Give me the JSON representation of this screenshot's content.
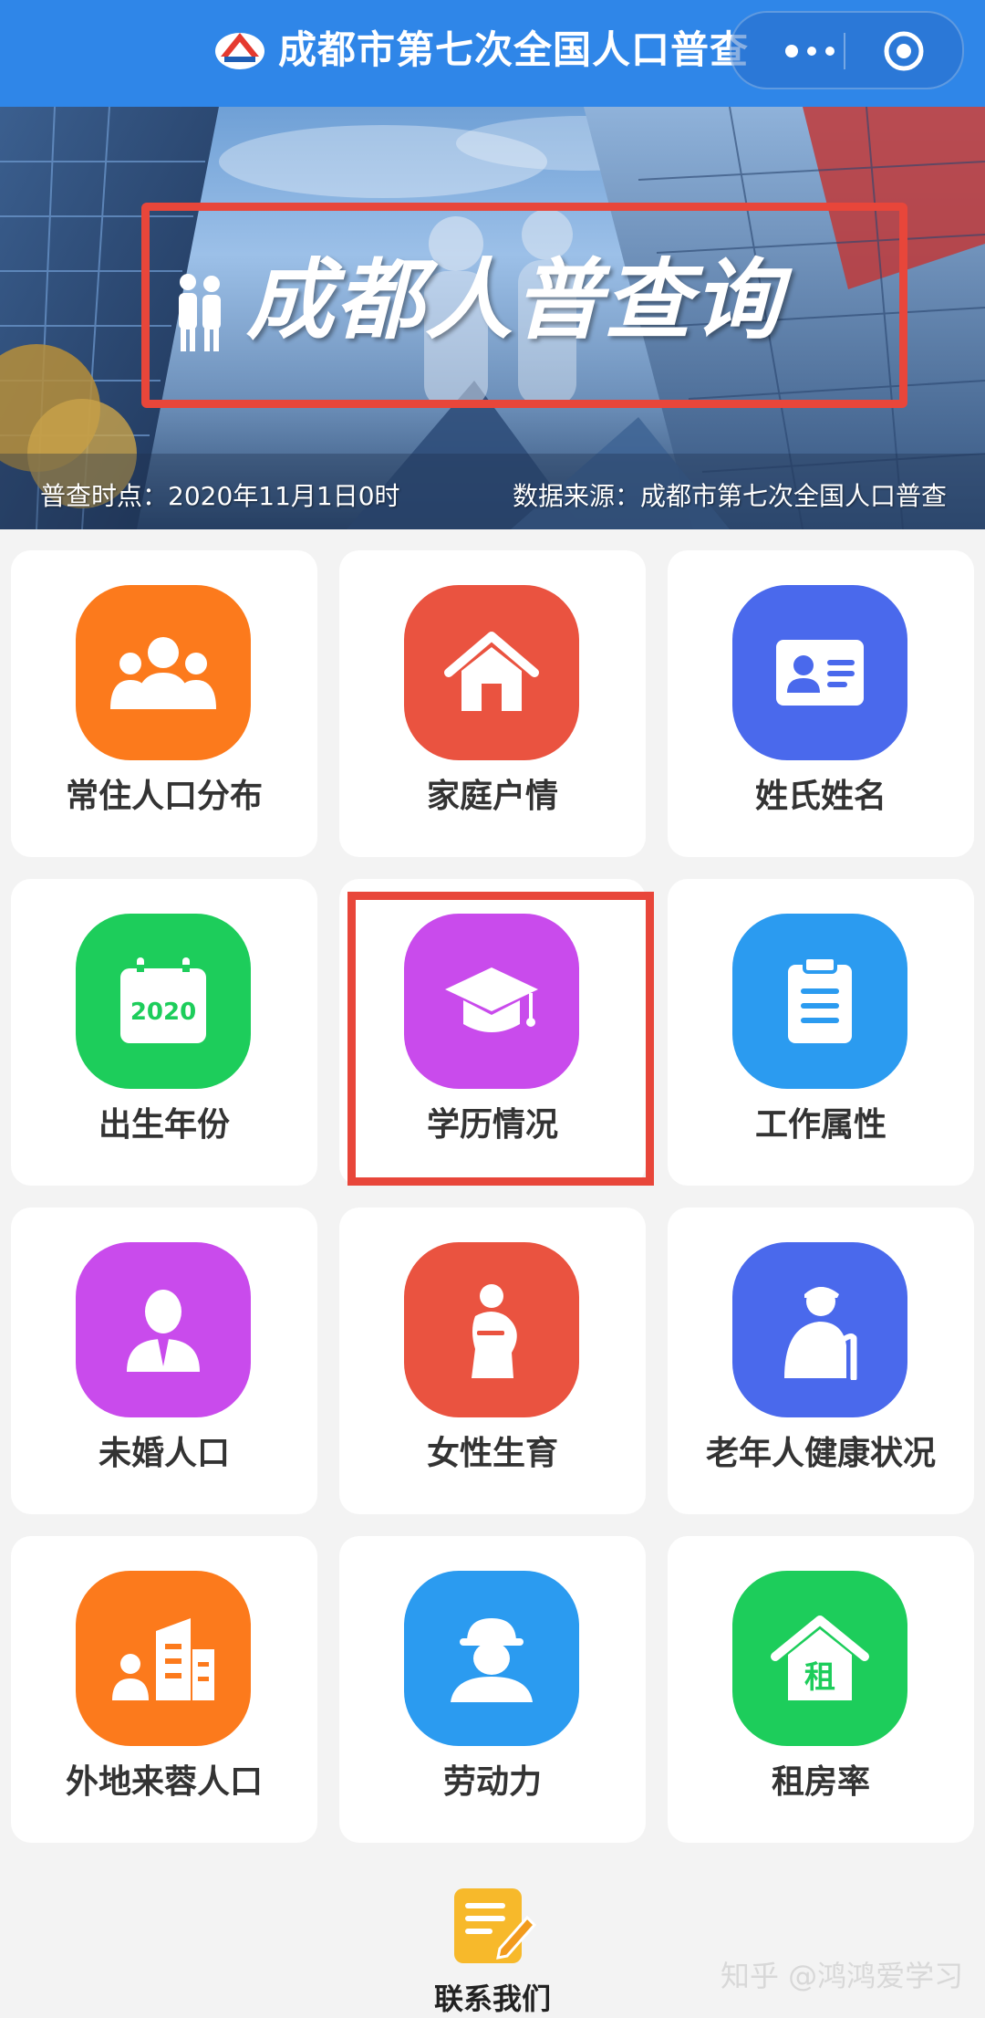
{
  "header": {
    "title": "成都市第七次全国人口普查",
    "logo_icon": "census-logo-icon",
    "menu_icon": "more-dots-icon",
    "close_icon": "target-circle-icon",
    "color": "#2f86e8"
  },
  "banner": {
    "logo_text": "成都人普查询",
    "census_time": "普查时点：2020年11月1日0时",
    "data_source": "数据来源：成都市第七次全国人口普查"
  },
  "menu": [
    {
      "label": "常住人口分布",
      "icon": "people-group-icon",
      "color": "#fc7a1c"
    },
    {
      "label": "家庭户情",
      "icon": "house-icon",
      "color": "#ea5340"
    },
    {
      "label": "姓氏姓名",
      "icon": "id-card-icon",
      "color": "#4a69ec"
    },
    {
      "label": "出生年份",
      "icon": "calendar-icon",
      "color": "#1dcd5b",
      "calendar_year": "2020"
    },
    {
      "label": "学历情况",
      "icon": "graduation-cap-icon",
      "color": "#c94bec",
      "highlighted": true
    },
    {
      "label": "工作属性",
      "icon": "clipboard-icon",
      "color": "#2b9bf0"
    },
    {
      "label": "未婚人口",
      "icon": "person-suit-icon",
      "color": "#c94bec"
    },
    {
      "label": "女性生育",
      "icon": "pregnant-woman-icon",
      "color": "#ea5340"
    },
    {
      "label": "老年人健康状况",
      "icon": "elderly-person-icon",
      "color": "#4a69ec"
    },
    {
      "label": "外地来蓉人口",
      "icon": "person-building-icon",
      "color": "#fc7a1c"
    },
    {
      "label": "劳动力",
      "icon": "worker-icon",
      "color": "#2b9bf0"
    },
    {
      "label": "租房率",
      "icon": "rent-house-icon",
      "color": "#1dcd5b",
      "rent_char": "租"
    }
  ],
  "footer": {
    "contact_label": "联系我们",
    "contact_icon": "edit-note-icon",
    "watermark": "知乎 @鸿鸿爱学习"
  }
}
